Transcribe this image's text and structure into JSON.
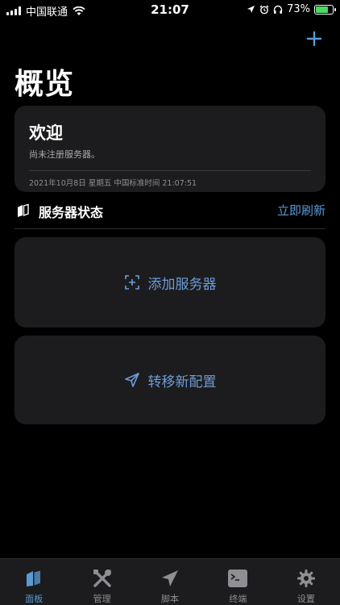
{
  "status_bar": {
    "carrier": "中国联通",
    "time": "21:07",
    "battery_percent": "73%",
    "battery_level": 0.73
  },
  "header": {
    "title": "概览",
    "add_icon": "plus-icon"
  },
  "welcome_card": {
    "title": "欢迎",
    "subtitle": "尚未注册服务器。",
    "datetime": "2021年10月8日 星期五 中国标准时间 21:07:51"
  },
  "server_status": {
    "title": "服务器状态",
    "refresh_label": "立即刷新"
  },
  "actions": {
    "add_server_label": "添加服务器",
    "migrate_config_label": "转移新配置"
  },
  "tabbar": {
    "tabs": [
      {
        "label": "面板",
        "icon": "dashboard-icon",
        "active": true
      },
      {
        "label": "管理",
        "icon": "tools-icon",
        "active": false
      },
      {
        "label": "脚本",
        "icon": "paperplane-icon",
        "active": false
      },
      {
        "label": "终端",
        "icon": "terminal-icon",
        "active": false
      },
      {
        "label": "设置",
        "icon": "gear-icon",
        "active": false
      }
    ]
  },
  "colors": {
    "accent": "#5b9bd5",
    "card_bg": "#1c1c1e",
    "battery": "#4cd964"
  }
}
